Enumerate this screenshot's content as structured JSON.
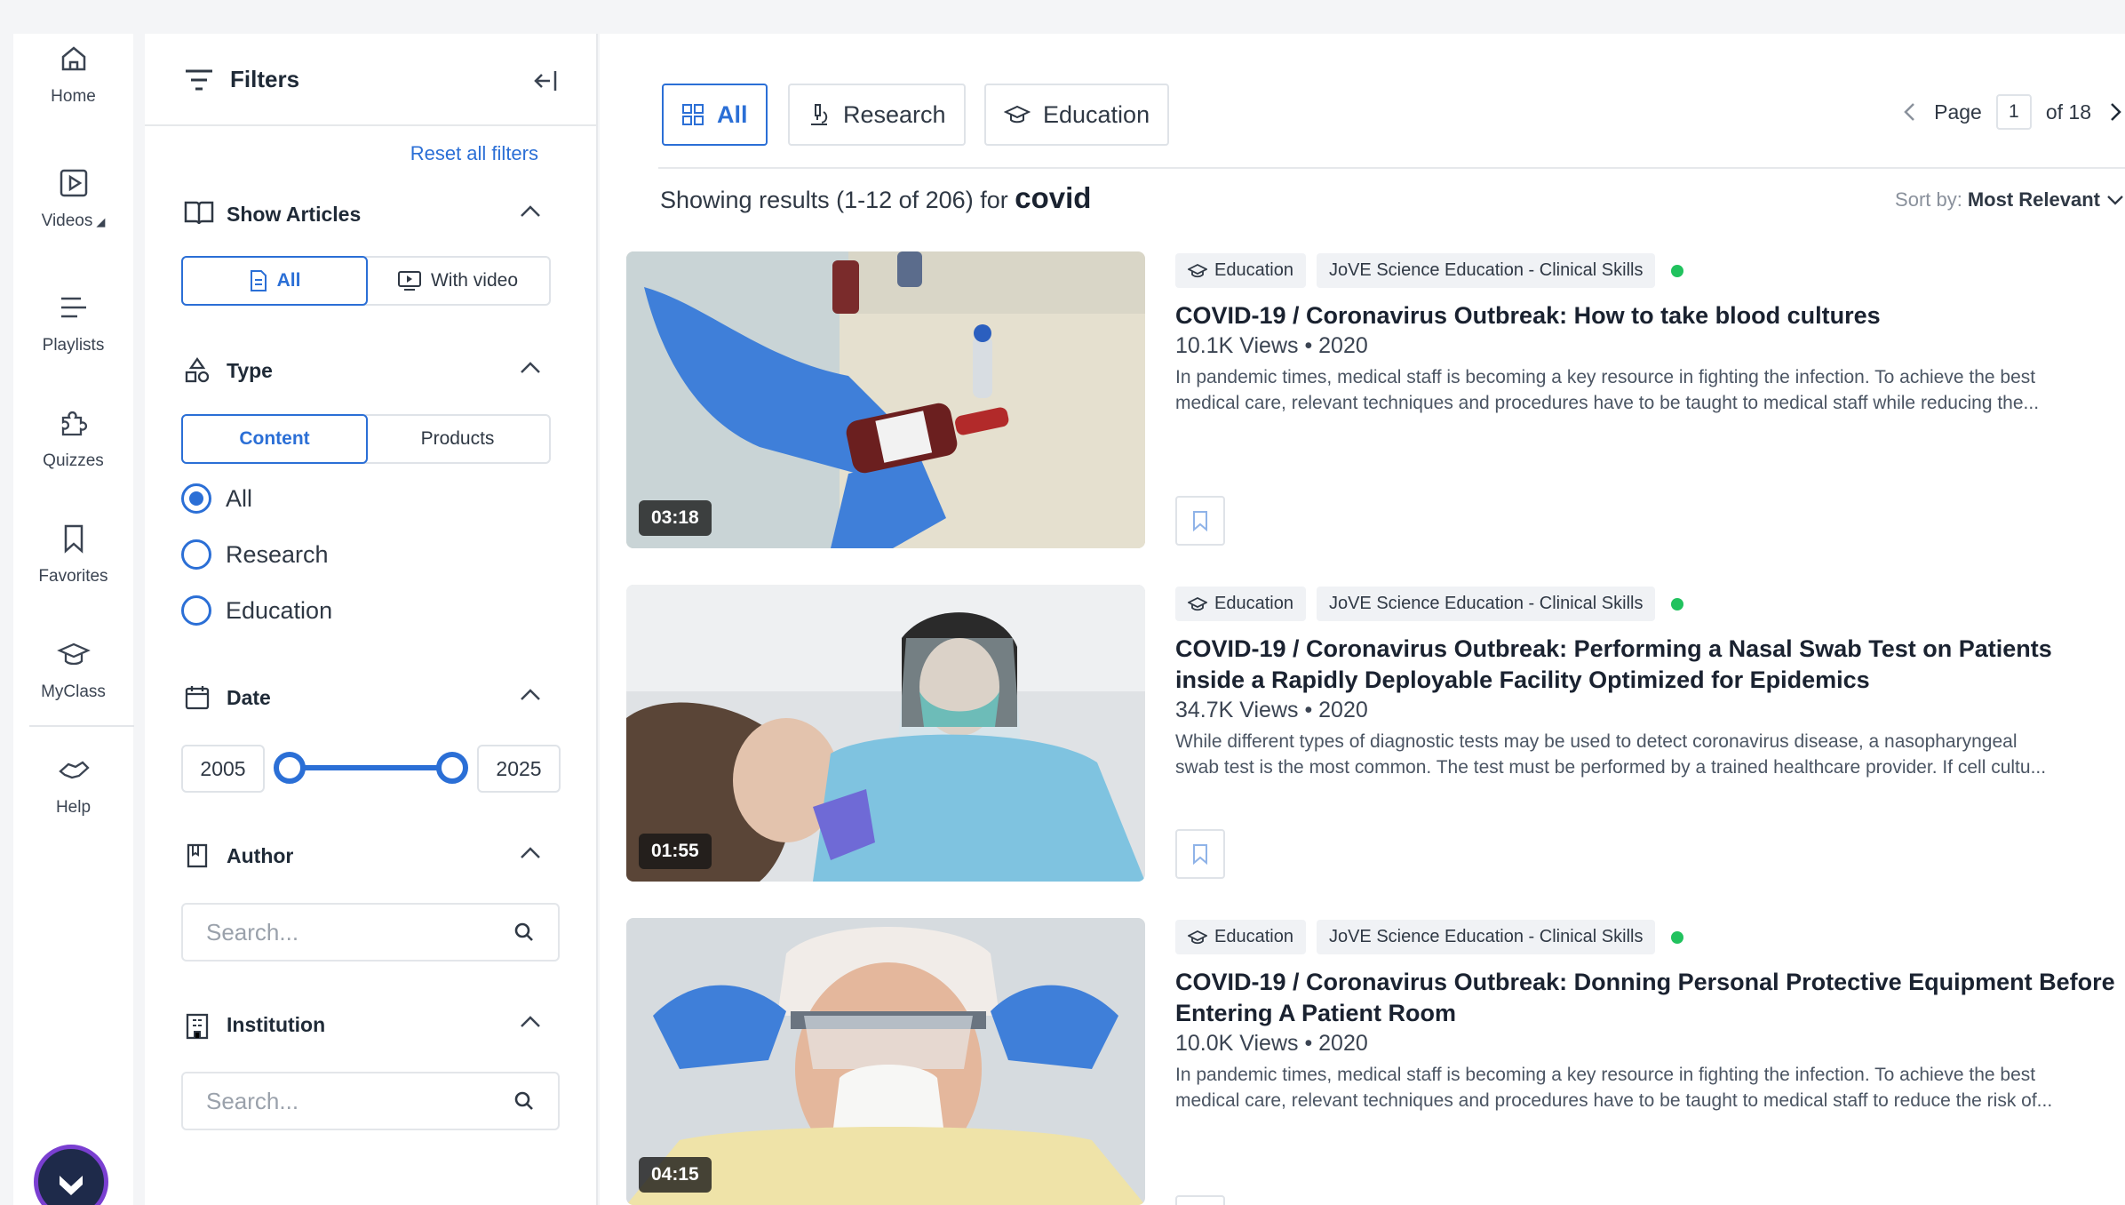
{
  "nav": {
    "items": [
      {
        "label": "Home",
        "icon": "home-icon"
      },
      {
        "label": "Videos",
        "icon": "video-icon"
      },
      {
        "label": "Playlists",
        "icon": "playlist-icon"
      },
      {
        "label": "Quizzes",
        "icon": "puzzle-icon"
      },
      {
        "label": "Favorites",
        "icon": "bookmark-icon"
      },
      {
        "label": "MyClass",
        "icon": "graduation-cap-icon"
      },
      {
        "label": "Help",
        "icon": "handshake-icon"
      }
    ]
  },
  "filters": {
    "title": "Filters",
    "reset_label": "Reset all filters",
    "show_articles": {
      "title": "Show Articles",
      "options": [
        "All",
        "With video"
      ],
      "selected": "All"
    },
    "type": {
      "title": "Type",
      "segments": [
        "Content",
        "Products"
      ],
      "selected_segment": "Content",
      "radios": [
        "All",
        "Research",
        "Education"
      ],
      "selected_radio": "All"
    },
    "date": {
      "title": "Date",
      "from": "2005",
      "to": "2025"
    },
    "author": {
      "title": "Author",
      "placeholder": "Search..."
    },
    "institution": {
      "title": "Institution",
      "placeholder": "Search..."
    }
  },
  "main": {
    "tabs": [
      {
        "label": "All",
        "icon": "grid-icon"
      },
      {
        "label": "Research",
        "icon": "microscope-icon"
      },
      {
        "label": "Education",
        "icon": "graduation-cap-icon"
      }
    ],
    "active_tab": "All",
    "pager": {
      "label": "Page",
      "current": "1",
      "total_text": "of 18"
    },
    "results_prefix": "Showing results (1-12 of 206) for",
    "query": "covid",
    "sort_label": "Sort by:",
    "sort_value": "Most Relevant",
    "results": [
      {
        "tag": "Education",
        "source": "JoVE Science Education - Clinical Skills",
        "title": "COVID-19 / Coronavirus Outbreak: How to take blood cultures",
        "views": "10.1K Views • 2020",
        "desc1": "In pandemic times, medical staff is becoming a key resource in fighting the infection. To achieve the best",
        "desc2": "medical care, relevant techniques and procedures have to be taught to medical staff while reducing the...",
        "duration": "03:18"
      },
      {
        "tag": "Education",
        "source": "JoVE Science Education - Clinical Skills",
        "title": "COVID-19 / Coronavirus Outbreak: Performing a Nasal Swab Test on Patients inside a Rapidly Deployable Facility Optimized for Epidemics",
        "views": "34.7K Views • 2020",
        "desc1": "While different types of diagnostic tests may be used to detect coronavirus disease, a nasopharyngeal",
        "desc2": "swab test is the most common. The test must be performed by a trained healthcare provider. If cell cultu...",
        "duration": "01:55"
      },
      {
        "tag": "Education",
        "source": "JoVE Science Education - Clinical Skills",
        "title": "COVID-19 / Coronavirus Outbreak: Donning Personal Protective Equipment Before Entering A Patient Room",
        "views": "10.0K Views • 2020",
        "desc1": "In pandemic times, medical staff is becoming a key resource in fighting the infection. To achieve the best",
        "desc2": "medical care, relevant techniques and procedures have to be taught to medical staff to reduce the risk of...",
        "duration": "04:15"
      }
    ]
  },
  "colors": {
    "accent": "#2b6fd6",
    "status_green": "#21c25e"
  }
}
